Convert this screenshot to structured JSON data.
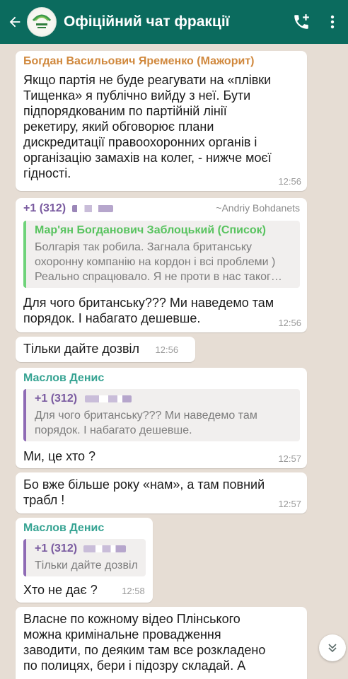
{
  "header": {
    "title": "Офіційний чат фракції"
  },
  "messages": {
    "m1": {
      "sender": "Богдан Васильович Яременко (Мажорит)",
      "text": "Якщо партія не буде реагувати на «плівки\nТищенка» я публічно вийду з неї. Бути\nпідпорядкованим по партійній лінії\nрекетиру, який обговорює плани\nдискредитації правоохоронних органів і\nорганізацію замахів на колег, - нижче моєї\nгідності.",
      "time": "12:56"
    },
    "m2": {
      "sender": "+1 (312)",
      "alias": "~Andriy Bohdanets",
      "quote_sender": "Мар'ян Богданович Заблоцький (Список)",
      "quote_text": "Болгарія так робила. Загнала британську\nохоронну компанію на кордон і всі проблеми )\nРеально спрацювало. Я не проти в нас таког…",
      "text": "Для чого британську??? Ми наведемо там\nпорядок. І набагато дешевше.",
      "time": "12:56"
    },
    "m3": {
      "text": "Тільки дайте дозвіл",
      "time": "12:56"
    },
    "m4": {
      "sender": "Маслов Денис",
      "quote_sender": "+1 (312)",
      "quote_text": "Для чого британську??? Ми наведемо там\nпорядок. І набагато дешевше.",
      "text": "Ми, це хто ?",
      "time": "12:57"
    },
    "m5": {
      "text": "Бо вже більше року «нам», а там повний\nтрабл !",
      "time": "12:57"
    },
    "m6": {
      "sender": "Маслов Денис",
      "quote_sender": "+1 (312)",
      "quote_text": "Тільки дайте дозвіл",
      "text": "Хто не дає ?",
      "time": "12:58"
    },
    "m7": {
      "text": "Власне по кожному відео Плінського\nможна кримінальне провадження\nзаводити, по деяким там все розкладено\nпо полицях, бери і підозру складай.  А"
    }
  },
  "colors": {
    "header_bg": "#0b6b5e",
    "chat_bg": "#e6ddd4",
    "orange_name": "#d0883d",
    "teal_name": "#35a392",
    "purple_name": "#7a5ba0",
    "green_quote": "#58c35f"
  },
  "icons": {
    "back": "arrow-left-icon",
    "avatar": "group-logo-icon",
    "add_call": "add-call-icon",
    "menu": "more-vert-icon",
    "scroll": "double-chevron-down-icon"
  }
}
